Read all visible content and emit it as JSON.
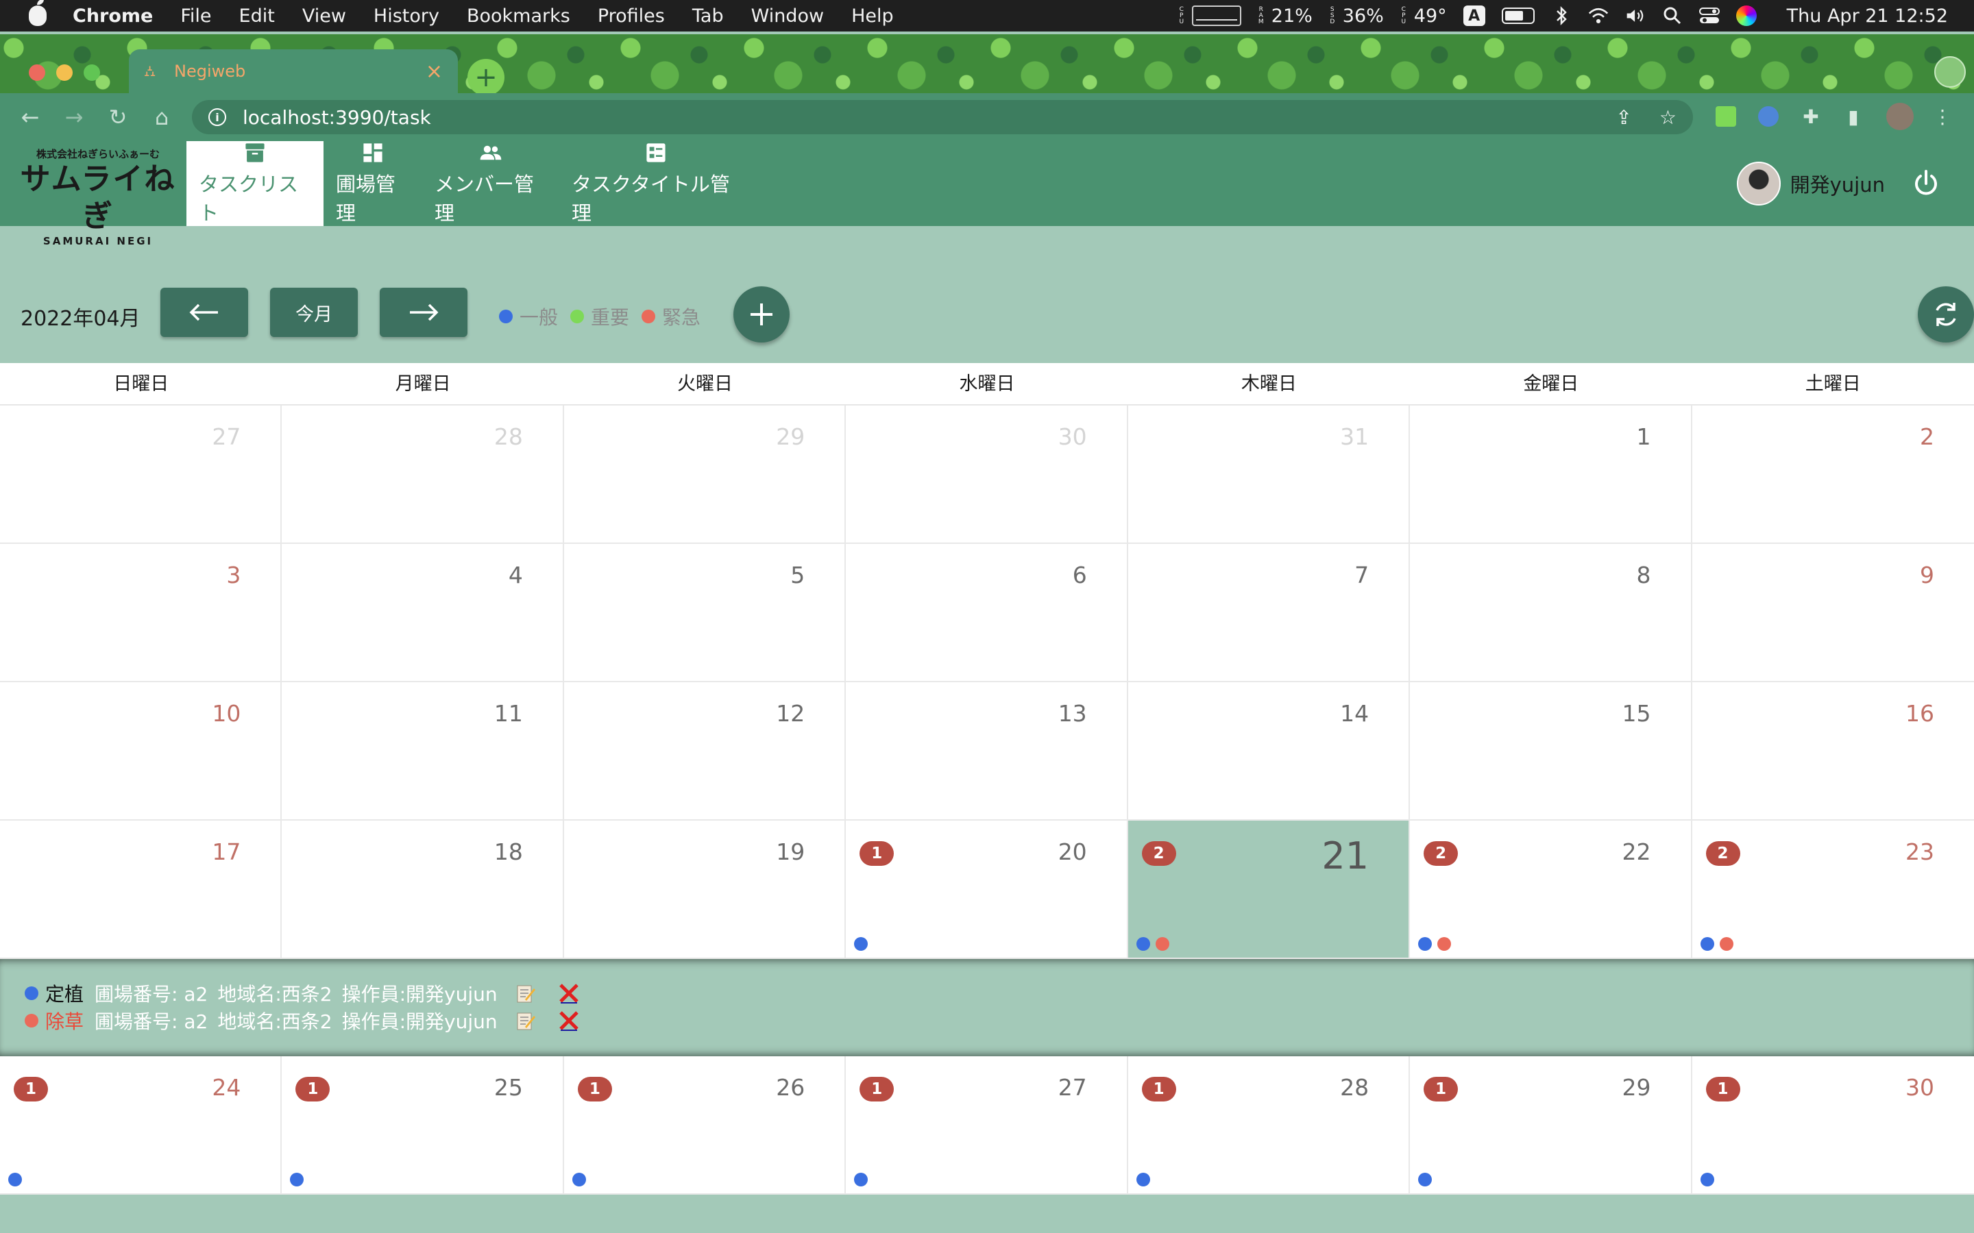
{
  "menubar": {
    "items": [
      "Chrome",
      "File",
      "Edit",
      "View",
      "History",
      "Bookmarks",
      "Profiles",
      "Tab",
      "Window",
      "Help"
    ],
    "ram_percent": "21%",
    "ssd_percent": "36%",
    "cpu_temp": "49°",
    "input_source": "A",
    "clock": "Thu Apr 21  12:52"
  },
  "browser": {
    "tab_title": "Negiweb",
    "url": "localhost:3990/task"
  },
  "app": {
    "logo_top": "株式会社ねぎらいふぁーむ",
    "logo_main": "サムライねぎ",
    "logo_sub": "SAMURAI NEGI",
    "nav": [
      {
        "label": "タスクリスト",
        "icon": "archive-icon"
      },
      {
        "label": "圃場管理",
        "icon": "dashboard-icon"
      },
      {
        "label": "メンバー管理",
        "icon": "people-icon"
      },
      {
        "label": "タスクタイトル管理",
        "icon": "list-alt-icon"
      }
    ],
    "user_name": "開発yujun"
  },
  "calendar": {
    "month": "2022年04月",
    "today_button": "今月",
    "legend": [
      {
        "label": "一般",
        "color": "#3a6fe0"
      },
      {
        "label": "重要",
        "color": "#7ed957"
      },
      {
        "label": "緊急",
        "color": "#ea6a5a"
      }
    ],
    "weekdays": [
      "日曜日",
      "月曜日",
      "火曜日",
      "水曜日",
      "木曜日",
      "金曜日",
      "土曜日"
    ],
    "weeks": [
      [
        {
          "day": "27",
          "other": true
        },
        {
          "day": "28",
          "other": true
        },
        {
          "day": "29",
          "other": true
        },
        {
          "day": "30",
          "other": true
        },
        {
          "day": "31",
          "other": true
        },
        {
          "day": "1"
        },
        {
          "day": "2",
          "weekend": true
        }
      ],
      [
        {
          "day": "3",
          "weekend": true
        },
        {
          "day": "4"
        },
        {
          "day": "5"
        },
        {
          "day": "6"
        },
        {
          "day": "7"
        },
        {
          "day": "8"
        },
        {
          "day": "9",
          "weekend": true
        }
      ],
      [
        {
          "day": "10",
          "weekend": true
        },
        {
          "day": "11"
        },
        {
          "day": "12"
        },
        {
          "day": "13"
        },
        {
          "day": "14"
        },
        {
          "day": "15"
        },
        {
          "day": "16",
          "weekend": true
        }
      ],
      [
        {
          "day": "17",
          "weekend": true
        },
        {
          "day": "18"
        },
        {
          "day": "19"
        },
        {
          "day": "20",
          "badge": "1",
          "dots": [
            "#3a6fe0"
          ]
        },
        {
          "day": "21",
          "badge": "2",
          "dots": [
            "#3a6fe0",
            "#ea6a5a"
          ],
          "today": true
        },
        {
          "day": "22",
          "badge": "2",
          "dots": [
            "#3a6fe0",
            "#ea6a5a"
          ]
        },
        {
          "day": "23",
          "badge": "2",
          "dots": [
            "#3a6fe0",
            "#ea6a5a"
          ],
          "weekend": true
        }
      ],
      [
        {
          "day": "24",
          "badge": "1",
          "dots": [
            "#3a6fe0"
          ],
          "weekend": true
        },
        {
          "day": "25",
          "badge": "1",
          "dots": [
            "#3a6fe0"
          ]
        },
        {
          "day": "26",
          "badge": "1",
          "dots": [
            "#3a6fe0"
          ]
        },
        {
          "day": "27",
          "badge": "1",
          "dots": [
            "#3a6fe0"
          ]
        },
        {
          "day": "28",
          "badge": "1",
          "dots": [
            "#3a6fe0"
          ]
        },
        {
          "day": "29",
          "badge": "1",
          "dots": [
            "#3a6fe0"
          ]
        },
        {
          "day": "30",
          "badge": "1",
          "dots": [
            "#3a6fe0"
          ],
          "weekend": true
        }
      ]
    ],
    "tasks": [
      {
        "name": "定植",
        "color": "#3a6fe0",
        "name_color": "#111111",
        "field": "圃場番号: a2",
        "area": "地域名:西条2",
        "operator": "操作員:開発yujun"
      },
      {
        "name": "除草",
        "color": "#ea6a5a",
        "name_color": "#ea4a3a",
        "field": "圃場番号: a2",
        "area": "地域名:西条2",
        "operator": "操作員:開発yujun"
      }
    ]
  }
}
